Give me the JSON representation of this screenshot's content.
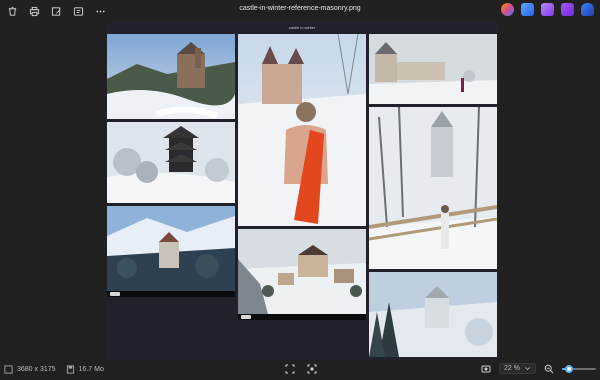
{
  "window": {
    "file_name": "castle-in-winter-reference-masonry.png"
  },
  "toolbar": {
    "left_icons": [
      "delete-icon",
      "print-icon",
      "edit-image-icon",
      "slideshow-icon",
      "more-icon"
    ],
    "right_app_icons": [
      {
        "name": "copilot-icon",
        "color": "#d84a8c"
      },
      {
        "name": "designer-icon",
        "color": "#3b82f6"
      },
      {
        "name": "clipchamp-icon",
        "color": "#7c3aed"
      },
      {
        "name": "clipchamp-video-icon",
        "color": "#9333ea"
      },
      {
        "name": "onedrive-icon",
        "color": "#2563eb"
      }
    ]
  },
  "sheet": {
    "title": "castle in winter",
    "background": "#20212b"
  },
  "status": {
    "dimensions": "3680 x 3175",
    "file_size": "16.7 Mo",
    "zoom_value": "22 %",
    "zoom_fraction": 0.22,
    "accent": "#5ab0ff"
  }
}
